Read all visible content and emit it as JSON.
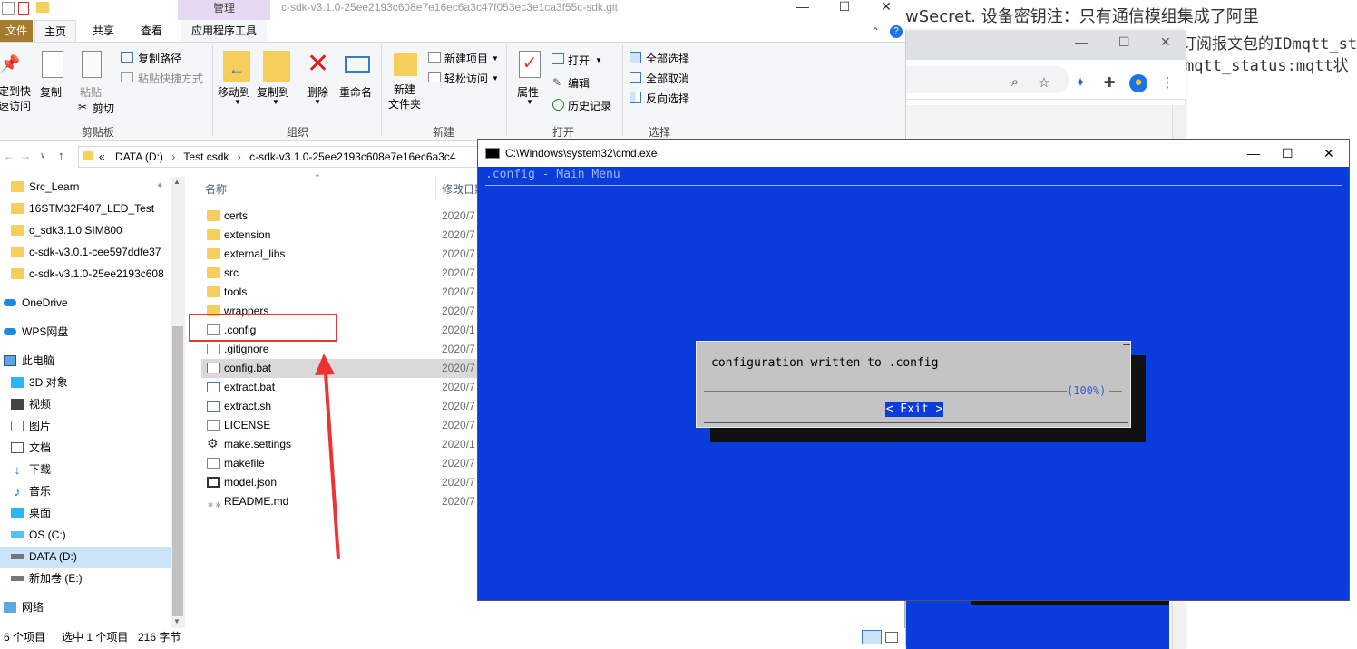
{
  "background_doc": {
    "line1": "wSecret. 设备密钥注：只有通信模组集成了阿里",
    "line2": "订阅报文包的IDmqtt_stat",
    "line3": "mqtt_status:mqtt状"
  },
  "explorer": {
    "ribbon_context_tab": "管理",
    "window_title": "c-sdk-v3.1.0-25ee2193c608e7e16ec6a3c47f053ec3e1ca3f55c-sdk.git",
    "tabs": {
      "file": "文件",
      "home": "主页",
      "share": "共享",
      "view": "查看",
      "app_tools": "应用程序工具"
    },
    "ribbon": {
      "pin_quick": "定到快\n速访问",
      "copy": "复制",
      "paste": "粘贴",
      "copy_path": "复制路径",
      "paste_shortcut": "粘贴快捷方式",
      "cut": "剪切",
      "clipboard_group": "剪贴板",
      "move_to": "移动到",
      "copy_to": "复制到",
      "delete": "删除",
      "rename": "重命名",
      "organize_group": "组织",
      "new_folder": "新建\n文件夹",
      "new_item": "新建项目",
      "easy_access": "轻松访问",
      "new_group": "新建",
      "properties": "属性",
      "open": "打开",
      "edit": "编辑",
      "history": "历史记录",
      "open_group": "打开",
      "select_all": "全部选择",
      "select_none": "全部取消",
      "invert_selection": "反向选择",
      "select_group": "选择"
    },
    "address": {
      "chevron": "«",
      "parts": [
        "DATA (D:)",
        "Test csdk",
        "c-sdk-v3.1.0-25ee2193c608e7e16ec6a3c4"
      ]
    },
    "nav": [
      {
        "label": "Src_Learn",
        "icon": "folder-icon"
      },
      {
        "label": "16STM32F407_LED_Test",
        "icon": "folder-icon"
      },
      {
        "label": "c_sdk3.1.0 SIM800",
        "icon": "folder-icon"
      },
      {
        "label": "c-sdk-v3.0.1-cee597ddfe37",
        "icon": "folder-icon"
      },
      {
        "label": "c-sdk-v3.1.0-25ee2193c608",
        "icon": "folder-icon"
      },
      {
        "label": "OneDrive",
        "icon": "cloud-icon"
      },
      {
        "label": "WPS网盘",
        "icon": "cloud-icon"
      },
      {
        "label": "此电脑",
        "icon": "computer-icon"
      },
      {
        "label": "3D 对象",
        "icon": "cube-icon"
      },
      {
        "label": "视频",
        "icon": "video-icon"
      },
      {
        "label": "图片",
        "icon": "picture-icon"
      },
      {
        "label": "文档",
        "icon": "document-icon"
      },
      {
        "label": "下载",
        "icon": "download-icon"
      },
      {
        "label": "音乐",
        "icon": "music-icon"
      },
      {
        "label": "桌面",
        "icon": "desktop-icon"
      },
      {
        "label": "OS (C:)",
        "icon": "drive-icon"
      },
      {
        "label": "DATA (D:)",
        "icon": "drive-icon"
      },
      {
        "label": "新加卷 (E:)",
        "icon": "drive-icon"
      },
      {
        "label": "网络",
        "icon": "network-icon"
      }
    ],
    "columns": {
      "name": "名称",
      "modified": "修改日期"
    },
    "files": [
      {
        "name": "certs",
        "date": "2020/7",
        "icon": "folder-icon"
      },
      {
        "name": "extension",
        "date": "2020/7",
        "icon": "folder-icon"
      },
      {
        "name": "external_libs",
        "date": "2020/7",
        "icon": "folder-icon"
      },
      {
        "name": "src",
        "date": "2020/7",
        "icon": "folder-icon"
      },
      {
        "name": "tools",
        "date": "2020/7",
        "icon": "folder-icon"
      },
      {
        "name": "wrappers",
        "date": "2020/7",
        "icon": "folder-icon"
      },
      {
        "name": ".config",
        "date": "2020/1",
        "icon": "config-file-icon"
      },
      {
        "name": ".gitignore",
        "date": "2020/7",
        "icon": "file-icon"
      },
      {
        "name": "config.bat",
        "date": "2020/7",
        "icon": "batch-file-icon"
      },
      {
        "name": "extract.bat",
        "date": "2020/7",
        "icon": "batch-file-icon"
      },
      {
        "name": "extract.sh",
        "date": "2020/7",
        "icon": "script-file-icon"
      },
      {
        "name": "LICENSE",
        "date": "2020/7",
        "icon": "file-icon"
      },
      {
        "name": "make.settings",
        "date": "2020/1",
        "icon": "settings-file-icon"
      },
      {
        "name": "makefile",
        "date": "2020/7",
        "icon": "file-icon"
      },
      {
        "name": "model.json",
        "date": "2020/7",
        "icon": "json-file-icon"
      },
      {
        "name": "README.md",
        "date": "2020/7",
        "icon": "markdown-file-icon"
      }
    ],
    "status": {
      "count": "6 个项目",
      "selected": "选中 1 个项目",
      "size": "216 字节"
    }
  },
  "cmd": {
    "title": "C:\\Windows\\system32\\cmd.exe",
    "menu_title": ".config - Main Menu",
    "dialog_message": "configuration written to .config",
    "progress": "(100%)",
    "exit_button": "< Exit >"
  },
  "colors": {
    "cmd_blue": "#0a3ddb",
    "highlight_red": "#e53935",
    "file_tab": "#a67c2c"
  }
}
